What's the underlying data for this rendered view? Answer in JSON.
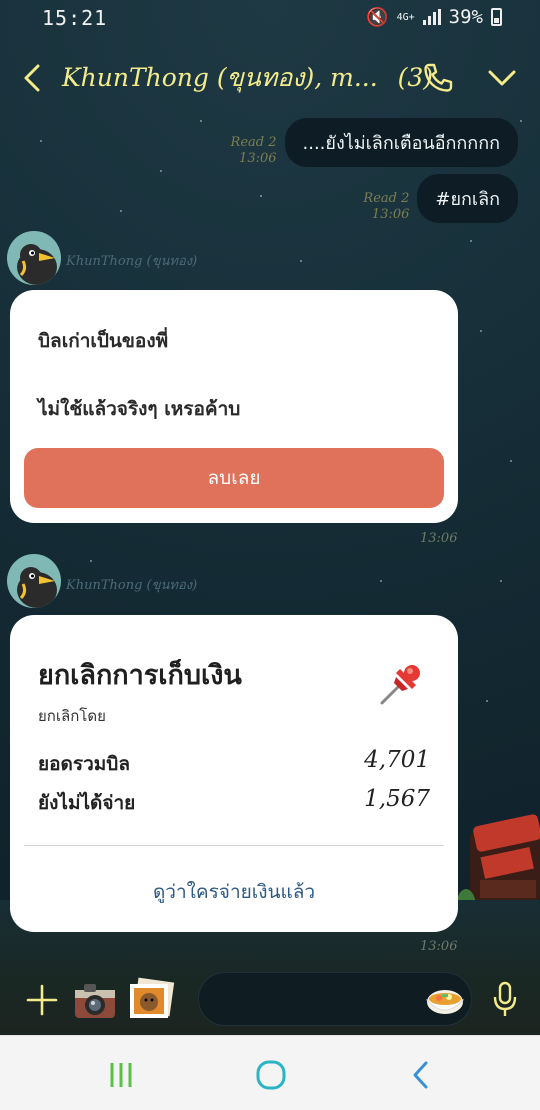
{
  "status_bar": {
    "time": "15:21",
    "network": "4G+",
    "battery": "39%"
  },
  "header": {
    "title": "KhunThong (ขุนทอง), m...",
    "member_count": "(3)"
  },
  "messages_out": [
    {
      "read": "Read 2",
      "time": "13:06",
      "text": "....ยังไม่เลิกเตือนอีกกกกก"
    },
    {
      "read": "Read 2",
      "time": "13:06",
      "text": "#ยกเลิก"
    }
  ],
  "sender": {
    "name": "KhunThong (ขุนทอง)"
  },
  "card1": {
    "line1": "บิลเก่าเป็นของพี่",
    "line2": "ไม่ใช้แล้วจริงๆ เหรอค้าบ",
    "button": "ลบเลย",
    "time": "13:06"
  },
  "card2": {
    "title": "ยกเลิกการเก็บเงิน",
    "subtitle": "ยกเลิกโดย",
    "rows": [
      {
        "label": "ยอดรวมบิล",
        "value": "4,701"
      },
      {
        "label": "ยังไม่ได้จ่าย",
        "value": "1,567"
      }
    ],
    "link": "ดูว่าใครจ่ายเงินแล้ว",
    "time": "13:06"
  },
  "input": {
    "placeholder": ""
  },
  "icons": {
    "back": "chevron-left-icon",
    "call": "phone-icon",
    "menu": "chevron-down-icon",
    "pin": "pushpin-icon",
    "plus": "plus-icon",
    "camera": "camera-icon",
    "gallery": "gallery-icon",
    "emoji": "sticker-icon",
    "mic": "microphone-icon"
  },
  "colors": {
    "header_text": "#f4ec8a",
    "delete_button": "#e0715a",
    "link": "#2e5a82",
    "nav_icons": "#2ab4c4"
  }
}
